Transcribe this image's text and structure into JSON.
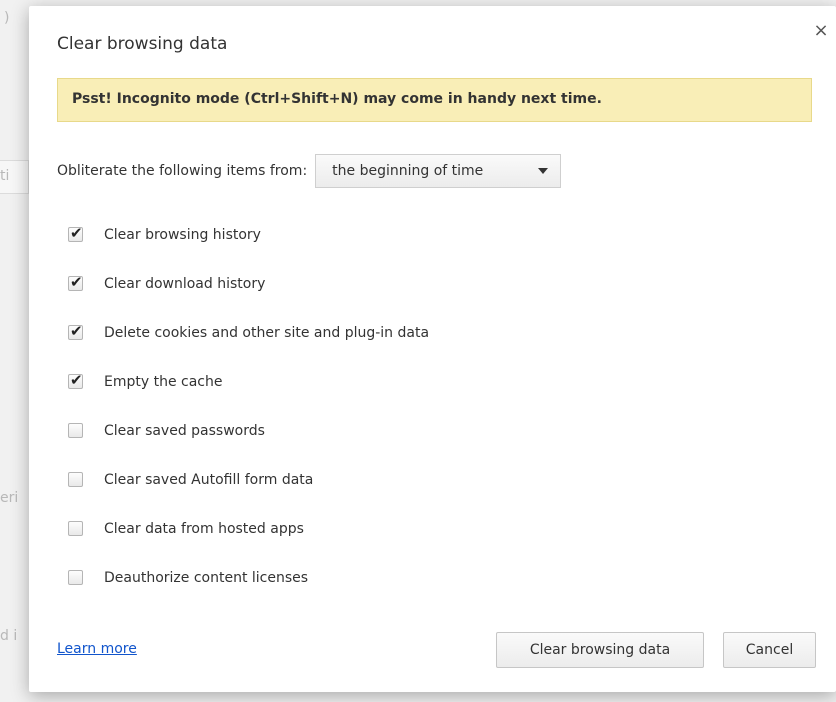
{
  "background": {
    "fragments": [
      ")",
      "ti",
      "eri",
      "d i"
    ]
  },
  "dialog": {
    "title": "Clear browsing data",
    "close_icon": "×",
    "banner": "Psst! Incognito mode (Ctrl+Shift+N) may come in handy next time.",
    "timerange": {
      "label": "Obliterate the following items from:",
      "selected": "the beginning of time"
    },
    "items": [
      {
        "label": "Clear browsing history",
        "checked": true
      },
      {
        "label": "Clear download history",
        "checked": true
      },
      {
        "label": "Delete cookies and other site and plug-in data",
        "checked": true
      },
      {
        "label": "Empty the cache",
        "checked": true
      },
      {
        "label": "Clear saved passwords",
        "checked": false
      },
      {
        "label": "Clear saved Autofill form data",
        "checked": false
      },
      {
        "label": "Clear data from hosted apps",
        "checked": false
      },
      {
        "label": "Deauthorize content licenses",
        "checked": false
      }
    ],
    "learn_more": "Learn more",
    "clear_button": "Clear browsing data",
    "cancel_button": "Cancel"
  },
  "colors": {
    "banner_bg": "#f9eeb7",
    "link": "#1155cc"
  }
}
